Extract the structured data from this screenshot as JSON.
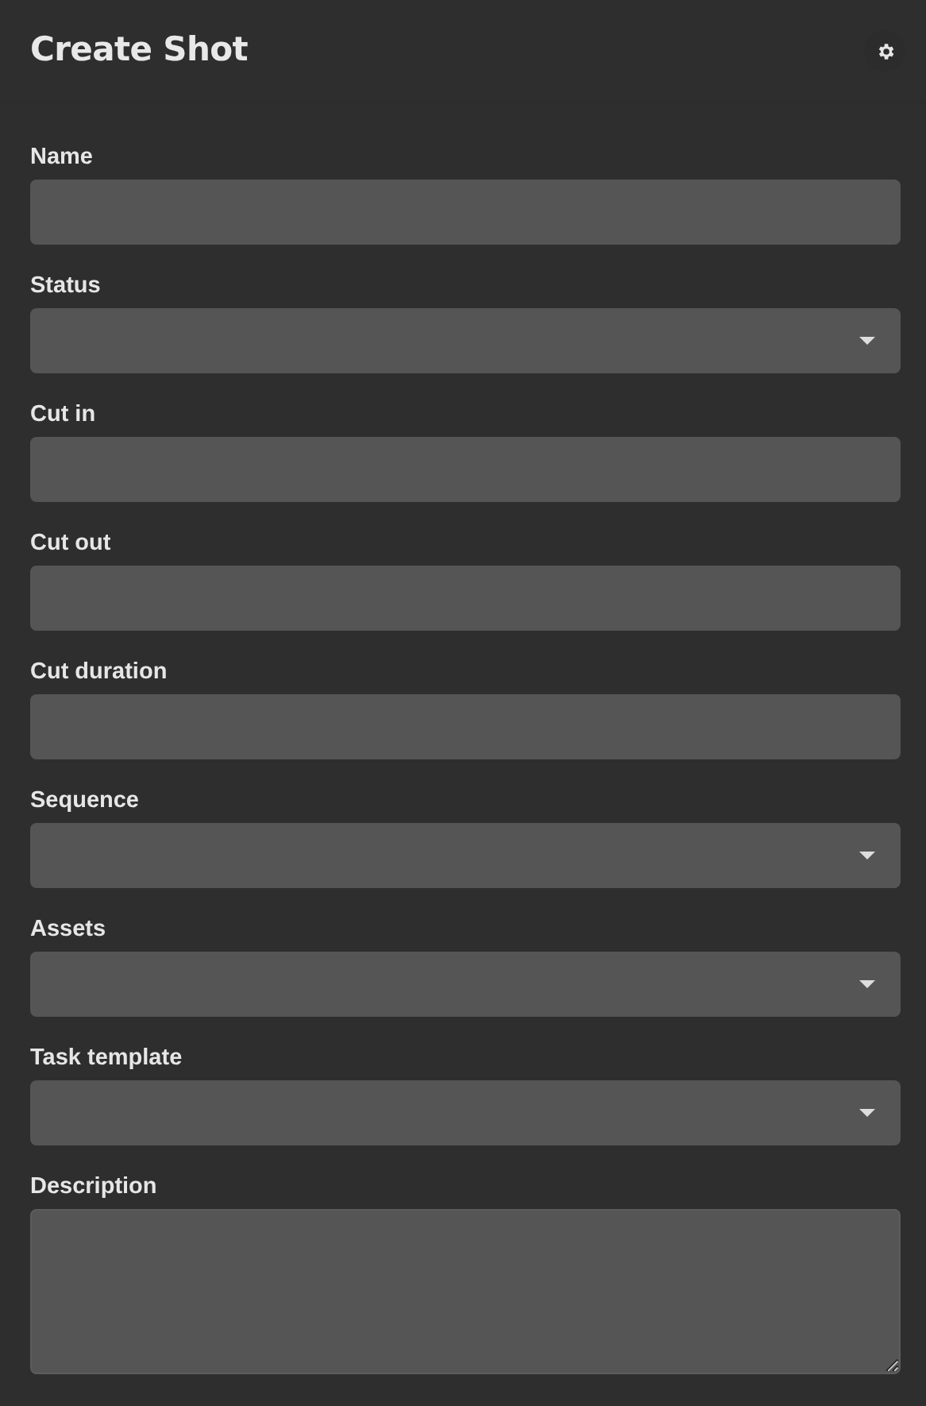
{
  "header": {
    "title": "Create Shot"
  },
  "fields": [
    {
      "label": "Name",
      "kind": "text"
    },
    {
      "label": "Status",
      "kind": "select"
    },
    {
      "label": "Cut in",
      "kind": "text"
    },
    {
      "label": "Cut out",
      "kind": "text"
    },
    {
      "label": "Cut duration",
      "kind": "text"
    },
    {
      "label": "Sequence",
      "kind": "select"
    },
    {
      "label": "Assets",
      "kind": "select"
    },
    {
      "label": "Task template",
      "kind": "select"
    },
    {
      "label": "Description",
      "kind": "textarea"
    }
  ]
}
